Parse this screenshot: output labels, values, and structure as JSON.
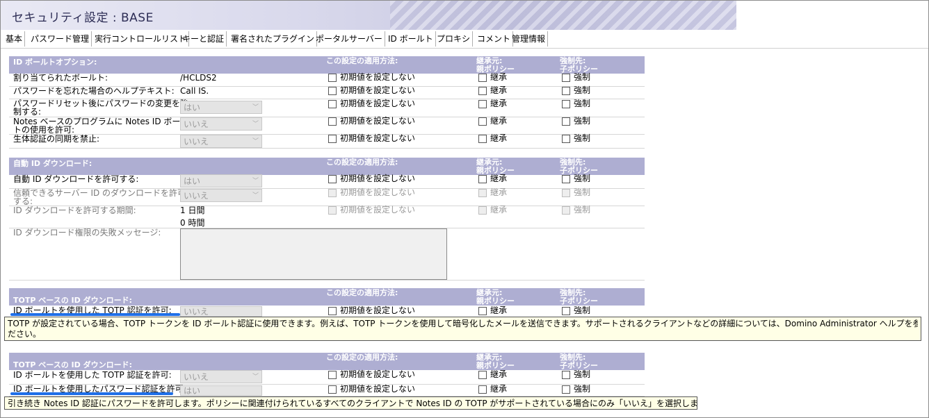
{
  "window_title": "セキュリティ設定 : BASE",
  "tabs": [
    "基本",
    "パスワード管理",
    "実行コントロールリスト",
    "キーと認証",
    "署名されたプラグイン",
    "ポータルサーバー",
    "ID ボールト",
    "プロキシ",
    "コメント",
    "管理情報"
  ],
  "active_tab": "ID ボールト",
  "columns": {
    "apply": "この設定の適用方法:",
    "inherit_1": "継承元:",
    "inherit_2": "親ポリシー",
    "enforce_1": "強制先:",
    "enforce_2": "子ポリシー"
  },
  "options": {
    "no_default": "初期値を設定しない",
    "inherit": "継承",
    "enforce": "強制"
  },
  "sections": {
    "vault_options": {
      "title": "ID ボールトオプション:",
      "rows": [
        {
          "label": "割り当てられたボールト:",
          "value": "/HCLDS2"
        },
        {
          "label": "パスワードを忘れた場合のヘルプテキスト:",
          "value": "Call IS."
        },
        {
          "label_1": "パスワードリセット後にパスワードの変更を強",
          "label_2": "制する:",
          "select": "はい"
        },
        {
          "label_1": "Notes ベースのプログラムに Notes ID ボール",
          "label_2": "トの使用を許可:",
          "select": "いいえ"
        },
        {
          "label": "生体認証の同期を禁止:",
          "select": "いいえ"
        }
      ]
    },
    "auto_download": {
      "title": "自動 ID ダウンロード:",
      "rows": [
        {
          "label": "自動 ID ダウンロードを許可する:",
          "select": "はい"
        },
        {
          "label_1": "信頼できるサーバー ID のダウンロードを許可",
          "label_2": "する:",
          "select": "いいえ"
        },
        {
          "label": "ID ダウンロードを許可する期間:",
          "value_1": "1 日間",
          "value_2": "0 時間"
        },
        {
          "label": "ID ダウンロード権限の失敗メッセージ:"
        }
      ]
    },
    "totp_1": {
      "title": "TOTP ベースの ID ダウンロード:",
      "rows": [
        {
          "label": "ID ボールトを使用した TOTP 認証を許可:",
          "select": "いいえ"
        }
      ],
      "tooltip_1": "TOTP が設定されている場合、TOTP トークンを ID ボールト認証に使用できます。例えば、TOTP トークンを使用して暗号化したメールを送信できます。サポートされるクライアントなどの詳細については、Domino Administrator ヘルプを参照してく",
      "tooltip_2": "ださい。"
    },
    "totp_2": {
      "title": "TOTP ベースの ID ダウンロード:",
      "rows": [
        {
          "label": "ID ボールトを使用した TOTP 認証を許可:",
          "select": "いいえ"
        },
        {
          "label": "ID ボールトを使用したパスワード認証を許可:",
          "select": "はい"
        }
      ],
      "tooltip": "引き続き Notes ID 認証にパスワードを許可します。ポリシーに関連付けられているすべてのクライアントで Notes ID の TOTP がサポートされている場合にのみ「いいえ」を選択します。"
    }
  },
  "colors": {
    "section_header": "#aeaed2",
    "highlight": "#1e6fe8",
    "tooltip_bg": "#ffffe6"
  }
}
